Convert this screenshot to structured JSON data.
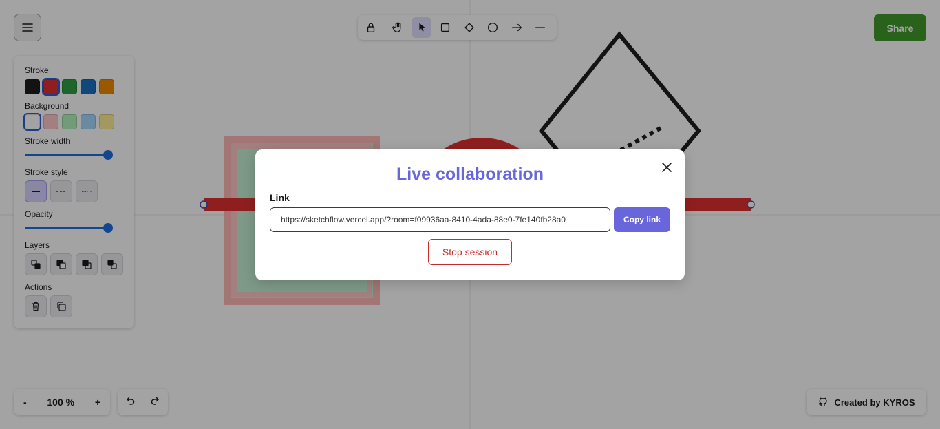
{
  "toolbar": {
    "tools": [
      {
        "name": "lock",
        "icon": "lock-icon"
      },
      {
        "name": "hand",
        "icon": "hand-icon"
      },
      {
        "name": "selection",
        "icon": "pointer-icon",
        "active": true
      },
      {
        "name": "rectangle",
        "icon": "rectangle-icon"
      },
      {
        "name": "diamond",
        "icon": "diamond-icon"
      },
      {
        "name": "ellipse",
        "icon": "circle-icon"
      },
      {
        "name": "arrow",
        "icon": "arrow-icon"
      },
      {
        "name": "line",
        "icon": "line-icon"
      }
    ]
  },
  "share": {
    "label": "Share",
    "color": "#3f9a2b"
  },
  "props": {
    "stroke_label": "Stroke",
    "stroke_colors": [
      "#1e1e1e",
      "#e03131",
      "#2f9e44",
      "#1971c2",
      "#f08c00"
    ],
    "stroke_selected": 1,
    "background_label": "Background",
    "background_colors": [
      "#ffffff",
      "#ffc9c9",
      "#b2f2bb",
      "#a5d8ff",
      "#ffec99"
    ],
    "background_selected": 0,
    "stroke_width_label": "Stroke width",
    "stroke_width_value": 1.0,
    "stroke_style_label": "Stroke style",
    "opacity_label": "Opacity",
    "opacity_value": 1.0,
    "layers_label": "Layers",
    "actions_label": "Actions"
  },
  "zoom": {
    "minus": "-",
    "level": "100 %",
    "plus": "+"
  },
  "credit": {
    "label": "Created by KYROS"
  },
  "modal": {
    "title": "Live collaboration",
    "link_label": "Link",
    "link_value": "https://sketchflow.vercel.app/?room=f09936aa-8410-4ada-88e0-7fe140fb28a0",
    "copy_label": "Copy link",
    "stop_label": "Stop session",
    "accent": "#6965db",
    "danger": "#c92a2a"
  },
  "colors": {
    "accent": "#6965db",
    "selection": "#e0dfff"
  }
}
